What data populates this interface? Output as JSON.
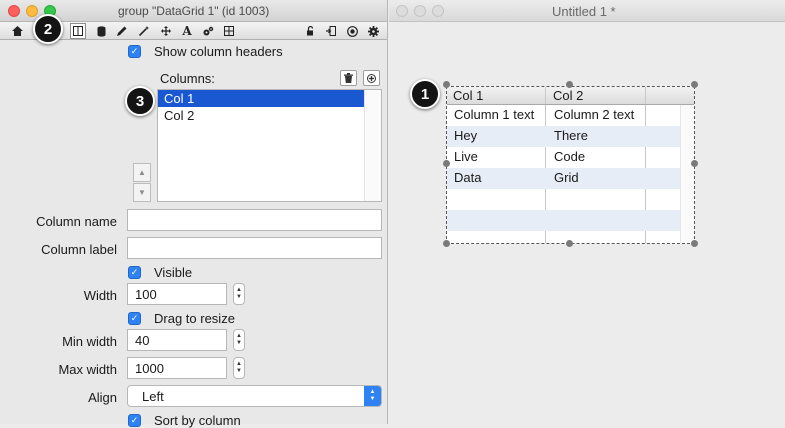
{
  "inspector": {
    "title": "group \"DataGrid 1\" (id 1003)",
    "toolbar_icons": [
      "home-icon",
      "table-icon",
      "database-icon",
      "pencil-icon",
      "magic-wand-icon",
      "move-icon",
      "text-icon",
      "gears-icon",
      "grid-icon",
      "lock-icon",
      "import-icon",
      "target-icon",
      "gear-icon"
    ],
    "toolbar_text_glyph": "A",
    "show_column_headers": "Show column headers",
    "columns_label": "Columns:",
    "columns": [
      "Col 1",
      "Col 2"
    ],
    "column_name_label": "Column name",
    "column_name_value": "",
    "column_label_label": "Column label",
    "column_label_value": "",
    "visible_label": "Visible",
    "width_label": "Width",
    "width_value": "100",
    "drag_to_resize_label": "Drag to resize",
    "min_width_label": "Min width",
    "min_width_value": "40",
    "max_width_label": "Max width",
    "max_width_value": "1000",
    "align_label": "Align",
    "align_value": "Left",
    "sort_by_column_label": "Sort by column"
  },
  "stack": {
    "title": "Untitled 1 *",
    "grid_headers": [
      "Col 1",
      "Col 2"
    ],
    "grid_rows": [
      [
        "Column 1 text",
        "Column 2 text"
      ],
      [
        "Hey",
        "There"
      ],
      [
        "Live",
        "Code"
      ],
      [
        "Data",
        "Grid"
      ],
      [
        "",
        ""
      ],
      [
        "",
        ""
      ]
    ]
  },
  "callouts": [
    "1",
    "2",
    "3"
  ],
  "colors": {
    "accent": "#2f82f3",
    "selection": "#1a58d2",
    "alt_row": "#e7edf7",
    "badge": "#141414"
  }
}
